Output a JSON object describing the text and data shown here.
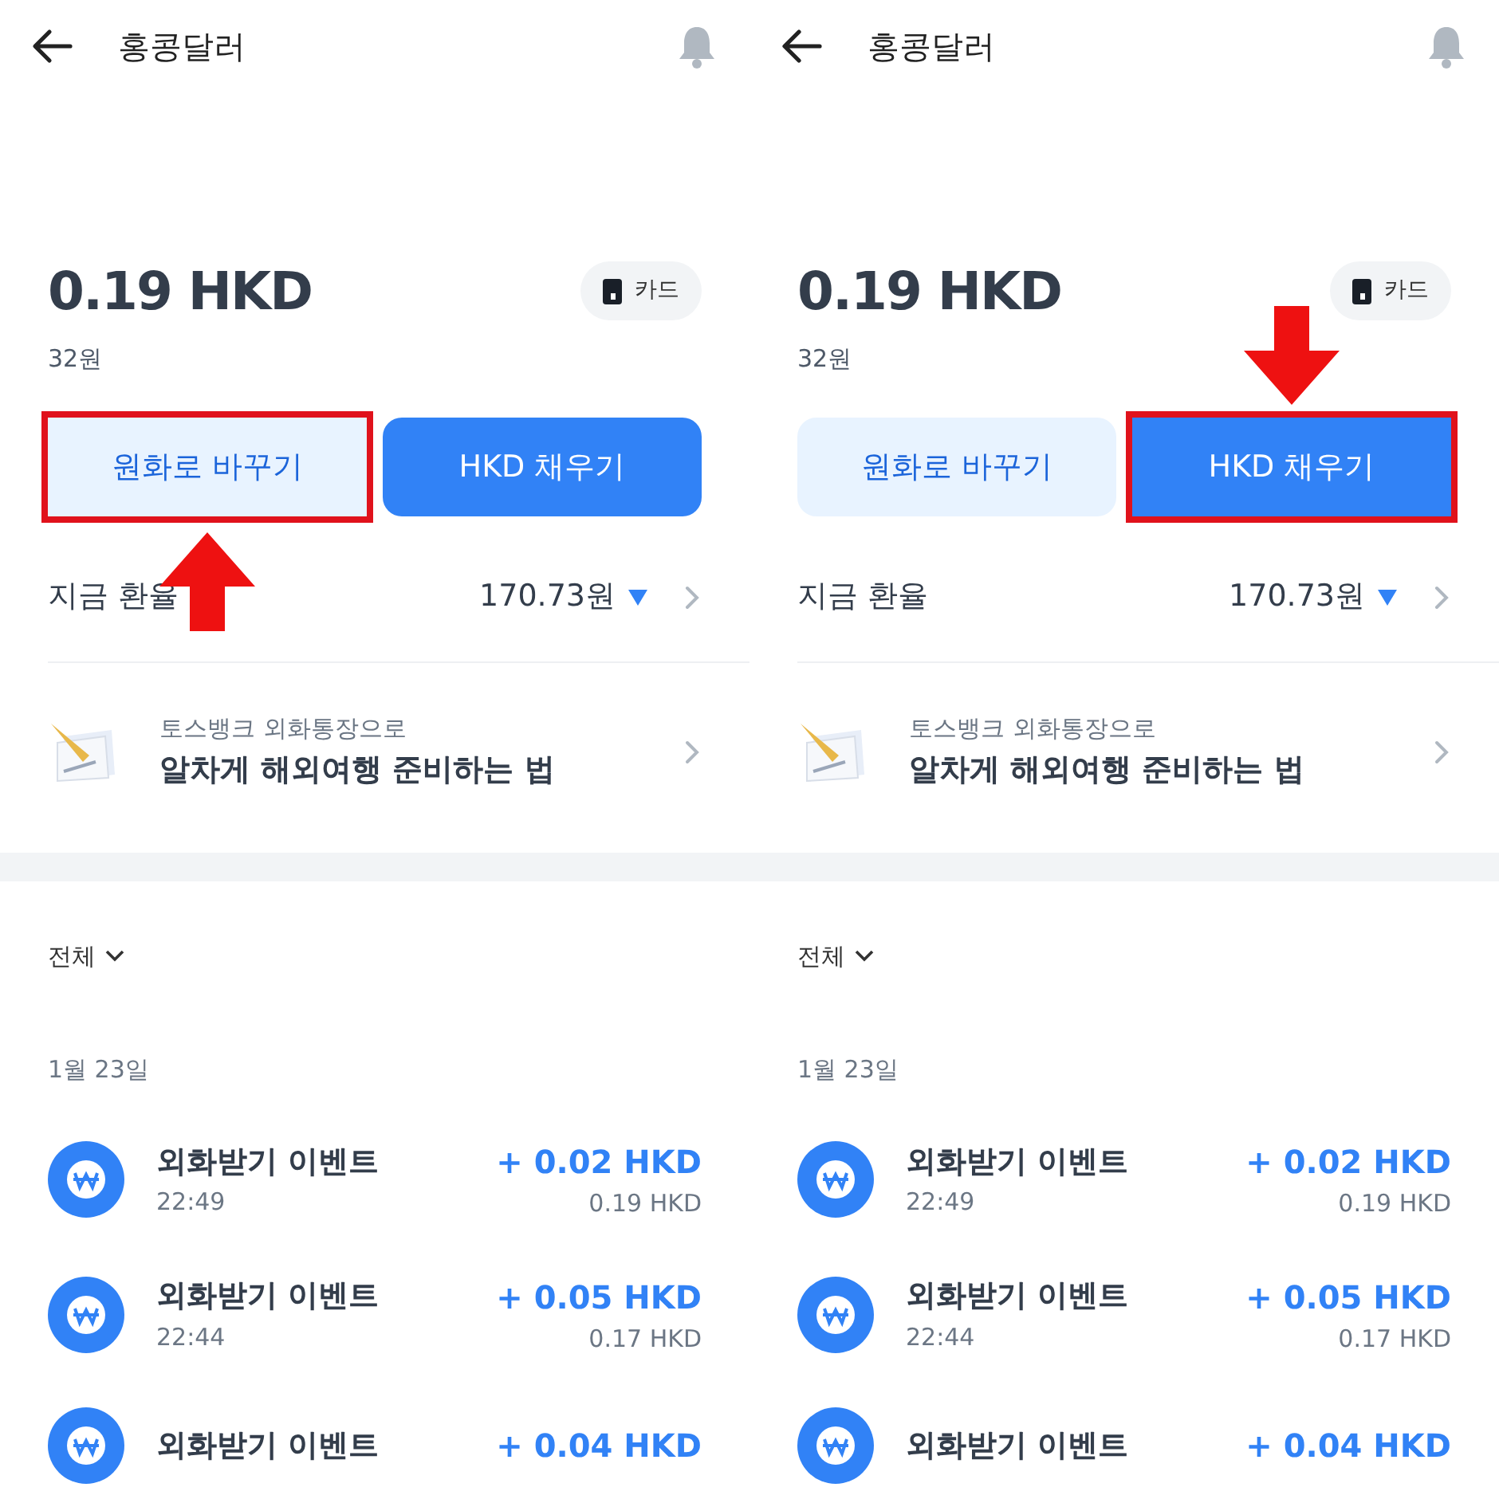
{
  "panels": [
    {
      "title": "홍콩달러",
      "balance": "0.19 HKD",
      "balance_krw": "32원",
      "card_label": "카드",
      "buttons": [
        {
          "label": "원화로 바꾸기",
          "kind": "secondary",
          "highlighted": true
        },
        {
          "label": "HKD 채우기",
          "kind": "primary",
          "highlighted": false
        }
      ],
      "annotation_arrow": {
        "kind": "up"
      },
      "rate": {
        "label": "지금 환율",
        "value": "170.73원"
      },
      "promo": {
        "subtitle": "토스뱅크 외화통장으로",
        "title": "알차게 해외여행 준비하는 법"
      },
      "filter": "전체",
      "date": "1월 23일",
      "transactions": [
        {
          "name": "외화받기 이벤트",
          "time": "22:49",
          "amount": "+ 0.02 HKD",
          "balance": "0.19 HKD"
        },
        {
          "name": "외화받기 이벤트",
          "time": "22:44",
          "amount": "+ 0.05 HKD",
          "balance": "0.17 HKD"
        },
        {
          "name": "외화받기 이벤트",
          "amount": "+ 0.04 HKD"
        }
      ]
    },
    {
      "title": "홍콩달러",
      "balance": "0.19 HKD",
      "balance_krw": "32원",
      "card_label": "카드",
      "buttons": [
        {
          "label": "원화로 바꾸기",
          "kind": "secondary",
          "highlighted": false
        },
        {
          "label": "HKD 채우기",
          "kind": "primary",
          "highlighted": true
        }
      ],
      "annotation_arrow": {
        "kind": "down"
      },
      "rate": {
        "label": "지금 환율",
        "value": "170.73원"
      },
      "promo": {
        "subtitle": "토스뱅크 외화통장으로",
        "title": "알차게 해외여행 준비하는 법"
      },
      "filter": "전체",
      "date": "1월 23일",
      "transactions": [
        {
          "name": "외화받기 이벤트",
          "time": "22:49",
          "amount": "+ 0.02 HKD",
          "balance": "0.19 HKD"
        },
        {
          "name": "외화받기 이벤트",
          "time": "22:44",
          "amount": "+ 0.05 HKD",
          "balance": "0.17 HKD"
        },
        {
          "name": "외화받기 이벤트",
          "amount": "+ 0.04 HKD"
        }
      ]
    }
  ]
}
